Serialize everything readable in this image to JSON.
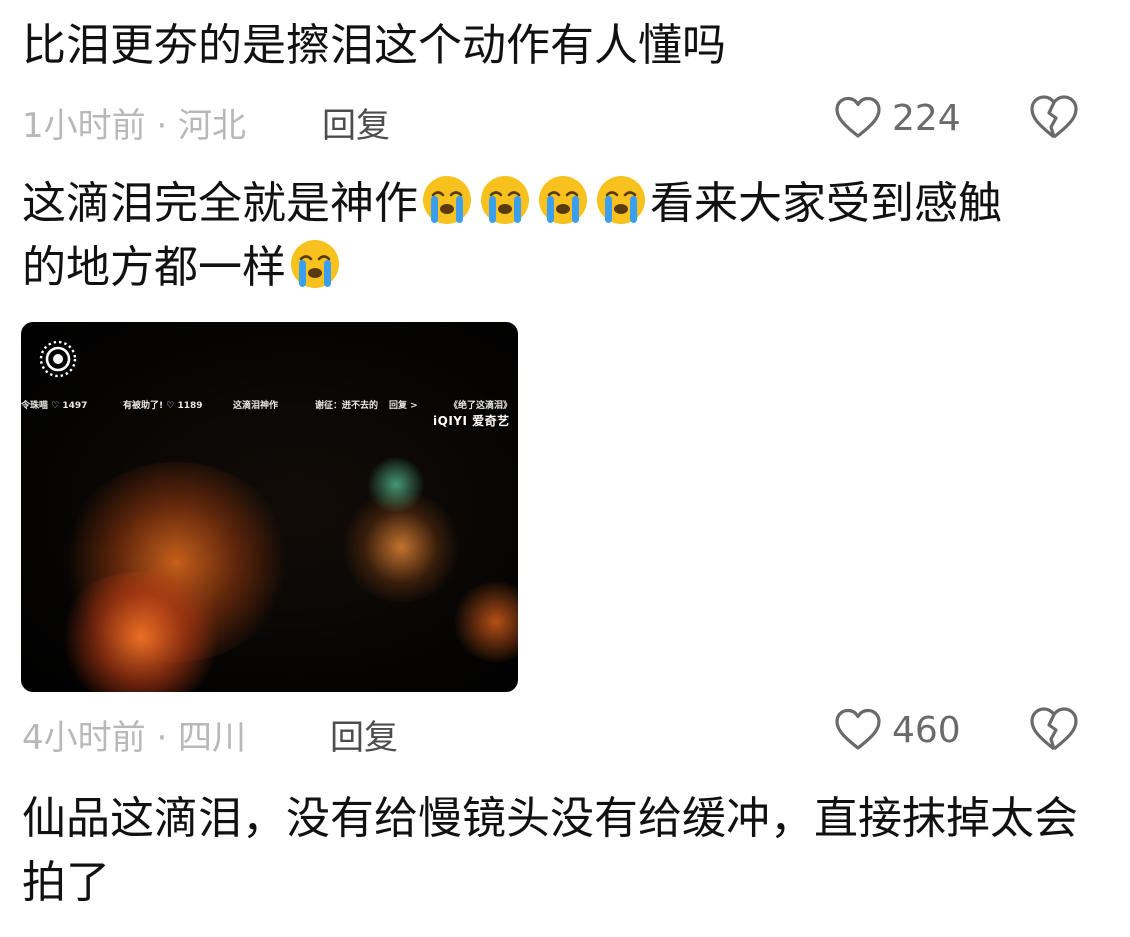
{
  "comments": [
    {
      "text": "比泪更夯的是擦泪这个动作有人懂吗",
      "time_location": "1小时前 · 河北",
      "reply_label": "回复",
      "like_count": "224"
    },
    {
      "text_before_emoji": "这滴泪完全就是神作",
      "text_after_emoji": "看来大家受到感触",
      "text_line2": "的地方都一样",
      "emoji_icon": "loudly-crying-face-icon",
      "video": {
        "live_indicator_icon": "live-photo-icon",
        "ticker": [
          "令珠喵 ♡ 1497",
          "有被助了! ♡ 1189",
          "这滴泪神作",
          "谢征：迸不去的",
          "回复 >",
          "《绝了这滴泪》"
        ],
        "brand": "iQIYI 爱奇艺"
      },
      "time_location": "4小时前 · 四川",
      "reply_label": "回复",
      "like_count": "460"
    },
    {
      "text": "仙品这滴泪，没有给慢镜头没有给缓冲，直接抹掉太会拍了"
    }
  ],
  "icons": {
    "like": "heart-outline-icon",
    "dislike": "broken-heart-icon"
  },
  "colors": {
    "text": "#111111",
    "meta": "#b8b8b8",
    "reply": "#4d4d4d",
    "icon": "#6a6a6a",
    "emoji_face": "#f7c21e",
    "emoji_tear": "#3a9ff0"
  }
}
